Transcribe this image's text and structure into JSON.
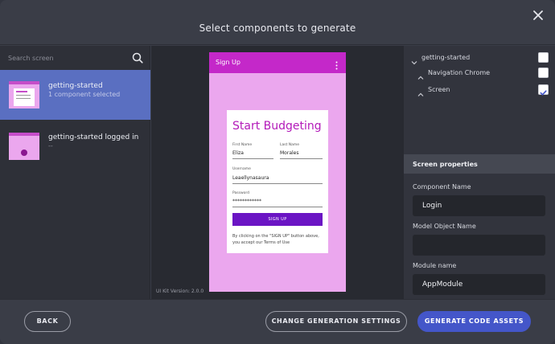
{
  "dialog": {
    "title": "Select components to generate"
  },
  "search": {
    "placeholder": "Search screen"
  },
  "screens": [
    {
      "name": "getting-started",
      "subtitle": "1 component selected",
      "active": true
    },
    {
      "name": "getting-started logged in",
      "subtitle": "--",
      "active": false
    }
  ],
  "preview": {
    "appbar_title": "Sign Up",
    "form_title": "Start Budgeting",
    "first_name_label": "First Name",
    "first_name_value": "Eliza",
    "last_name_label": "Last Name",
    "last_name_value": "Morales",
    "username_label": "Username",
    "username_value": "Leaellynasaura",
    "password_label": "Password",
    "password_value": "************",
    "signup_button": "SIGN UP",
    "terms_text": "By clicking on the \"SIGN UP\" button above, you accept our Terms of Use",
    "kit_version": "UI Kit Version: 2.0.0"
  },
  "tree": {
    "root": {
      "label": "getting-started",
      "checked": false
    },
    "children": [
      {
        "label": "Navigation Chrome",
        "checked": false
      },
      {
        "label": "Screen",
        "checked": true
      }
    ]
  },
  "properties": {
    "header": "Screen properties",
    "component_name_label": "Component Name",
    "component_name_value": "Login",
    "model_object_label": "Model Object Name",
    "model_object_value": "",
    "module_name_label": "Module name",
    "module_name_value": "AppModule"
  },
  "footer": {
    "back": "BACK",
    "change_settings": "CHANGE GENERATION SETTINGS",
    "generate": "GENERATE CODE ASSETS"
  },
  "colors": {
    "accent": "#4456c9",
    "active_item": "#5a6fc1",
    "appbar": "#c428c9",
    "phone_bg": "#eba7ee",
    "signup_button": "#6b15c4"
  }
}
